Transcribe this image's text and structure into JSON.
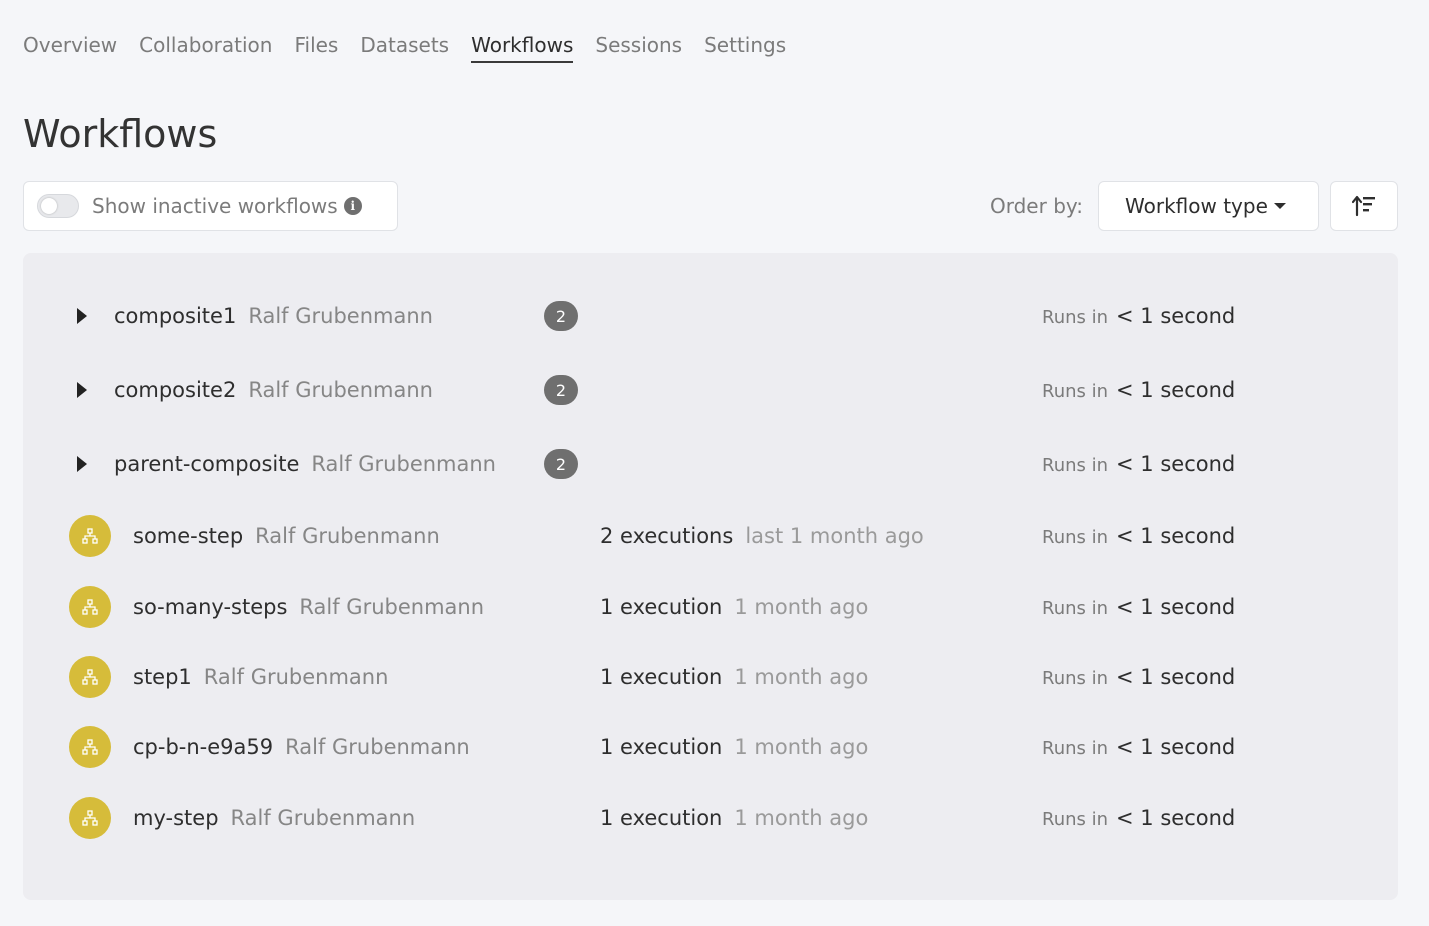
{
  "tabs": [
    {
      "label": "Overview"
    },
    {
      "label": "Collaboration"
    },
    {
      "label": "Files"
    },
    {
      "label": "Datasets"
    },
    {
      "label": "Workflows",
      "active": true
    },
    {
      "label": "Sessions"
    },
    {
      "label": "Settings"
    }
  ],
  "page": {
    "title": "Workflows"
  },
  "filter": {
    "toggle_label": "Show inactive workflows",
    "toggle_on": false
  },
  "order": {
    "label": "Order by:",
    "selected": "Workflow type"
  },
  "colors": {
    "step_icon_bg": "#d6bc3a",
    "badge_bg": "#6f6f6f"
  },
  "workflows": [
    {
      "name": "composite1",
      "author": "Ralf Grubenmann",
      "kind": "composite",
      "children": "2",
      "runs_label": "Runs in",
      "runs_value": "< 1 second"
    },
    {
      "name": "composite2",
      "author": "Ralf Grubenmann",
      "kind": "composite",
      "children": "2",
      "runs_label": "Runs in",
      "runs_value": "< 1 second"
    },
    {
      "name": "parent-composite",
      "author": "Ralf Grubenmann",
      "kind": "composite",
      "children": "2",
      "runs_label": "Runs in",
      "runs_value": "< 1 second"
    },
    {
      "name": "some-step",
      "author": "Ralf Grubenmann",
      "kind": "step",
      "executions": "2 executions",
      "last_run": "last 1 month ago",
      "runs_label": "Runs in",
      "runs_value": "< 1 second"
    },
    {
      "name": "so-many-steps",
      "author": "Ralf Grubenmann",
      "kind": "step",
      "executions": "1 execution",
      "last_run": "1 month ago",
      "runs_label": "Runs in",
      "runs_value": "< 1 second"
    },
    {
      "name": "step1",
      "author": "Ralf Grubenmann",
      "kind": "step",
      "executions": "1 execution",
      "last_run": "1 month ago",
      "runs_label": "Runs in",
      "runs_value": "< 1 second"
    },
    {
      "name": "cp-b-n-e9a59",
      "author": "Ralf Grubenmann",
      "kind": "step",
      "executions": "1 execution",
      "last_run": "1 month ago",
      "runs_label": "Runs in",
      "runs_value": "< 1 second"
    },
    {
      "name": "my-step",
      "author": "Ralf Grubenmann",
      "kind": "step",
      "executions": "1 execution",
      "last_run": "1 month ago",
      "runs_label": "Runs in",
      "runs_value": "< 1 second"
    }
  ]
}
